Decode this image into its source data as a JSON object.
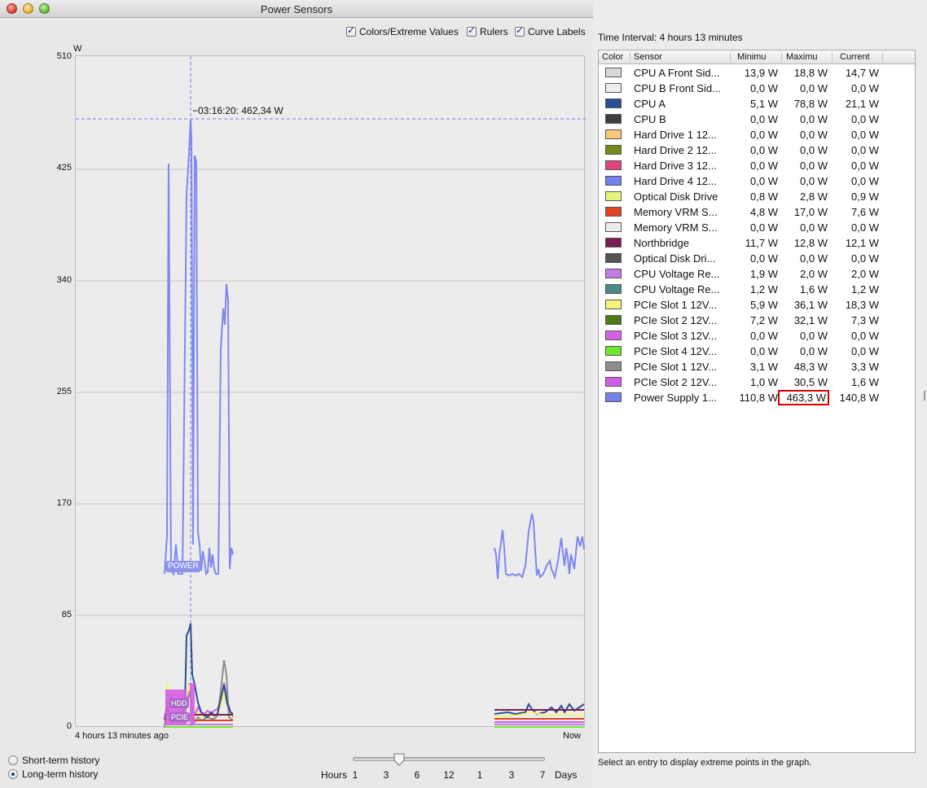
{
  "window": {
    "title": "Power Sensors",
    "options": [
      {
        "label": "Colors/Extreme Values",
        "checked": true
      },
      {
        "label": "Rulers",
        "checked": true
      },
      {
        "label": "Curve Labels",
        "checked": true
      }
    ]
  },
  "graph": {
    "unit": "W",
    "yticks": [
      "510",
      "425",
      "340",
      "255",
      "170",
      "85",
      "0"
    ],
    "x_left_label": "4 hours 13 minutes  ago",
    "x_right_label": "Now",
    "ruler_label": "−03:16:20: 462,34 W",
    "curve_label_power": "POWER",
    "curve_label_pcie": "PCIE",
    "curve_label_hdd": "HDD"
  },
  "chart_data": {
    "type": "line",
    "xlabel": "",
    "ylabel": "W",
    "ylim": [
      0,
      510
    ],
    "grid": true,
    "series": [
      {
        "name": "Power Supply",
        "color": "#7f88f0",
        "note_points_w": [
          120,
          430,
          120,
          130,
          120,
          432,
          462,
          120,
          432,
          130,
          120,
          120,
          330,
          345,
          130,
          120,
          120,
          135,
          160,
          120,
          140,
          145,
          150
        ]
      },
      {
        "name": "CPU A",
        "color": "#2b4f92",
        "peak_w": 79
      }
    ]
  },
  "history": {
    "short_label": "Short-term history",
    "long_label": "Long-term history",
    "selected": "long"
  },
  "slider": {
    "hours_label": "Hours",
    "days_label": "Days",
    "ticks": [
      "1",
      "3",
      "6",
      "12",
      "1",
      "3",
      "7"
    ]
  },
  "panel": {
    "interval": "Time Interval: 4 hours 13 minutes",
    "columns": {
      "color": "Color",
      "sensor": "Sensor",
      "min": "Minimu",
      "max": "Maximu",
      "current": "Current"
    },
    "status": "Select an entry to display extreme points in the graph."
  },
  "sensors": [
    {
      "name": "CPU A Front Sid...",
      "color": "#d9d9d9",
      "min": "13,9 W",
      "max": "18,8 W",
      "cur": "14,7 W"
    },
    {
      "name": "CPU B Front Sid...",
      "color": "#eeeeee",
      "min": "0,0 W",
      "max": "0,0 W",
      "cur": "0,0 W"
    },
    {
      "name": "CPU A",
      "color": "#2b4f92",
      "min": "5,1 W",
      "max": "78,8 W",
      "cur": "21,1 W"
    },
    {
      "name": "CPU B",
      "color": "#3d3d3d",
      "min": "0,0 W",
      "max": "0,0 W",
      "cur": "0,0 W"
    },
    {
      "name": "Hard Drive 1 12...",
      "color": "#f8c87a",
      "min": "0,0 W",
      "max": "0,0 W",
      "cur": "0,0 W"
    },
    {
      "name": "Hard Drive 2 12...",
      "color": "#6f8a1e",
      "min": "0,0 W",
      "max": "0,0 W",
      "cur": "0,0 W"
    },
    {
      "name": "Hard Drive 3 12...",
      "color": "#e0457f",
      "min": "0,0 W",
      "max": "0,0 W",
      "cur": "0,0 W"
    },
    {
      "name": "Hard Drive 4 12...",
      "color": "#7480ee",
      "min": "0,0 W",
      "max": "0,0 W",
      "cur": "0,0 W"
    },
    {
      "name": "Optical Disk Drive",
      "color": "#e6f57a",
      "min": "0,8 W",
      "max": "2,8 W",
      "cur": "0,9 W"
    },
    {
      "name": "Memory VRM S...",
      "color": "#e0451f",
      "min": "4,8 W",
      "max": "17,0 W",
      "cur": "7,6 W"
    },
    {
      "name": "Memory VRM S...",
      "color": "#eeeeee",
      "min": "0,0 W",
      "max": "0,0 W",
      "cur": "0,0 W"
    },
    {
      "name": "Northbridge",
      "color": "#7a2050",
      "min": "11,7 W",
      "max": "12,8 W",
      "cur": "12,1 W"
    },
    {
      "name": "Optical Disk Dri...",
      "color": "#555555",
      "min": "0,0 W",
      "max": "0,0 W",
      "cur": "0,0 W"
    },
    {
      "name": "CPU Voltage Re...",
      "color": "#c57ae8",
      "min": "1,9 W",
      "max": "2,0 W",
      "cur": "2,0 W"
    },
    {
      "name": "CPU Voltage Re...",
      "color": "#4a8a8a",
      "min": "1,2 W",
      "max": "1,6 W",
      "cur": "1,2 W"
    },
    {
      "name": "PCIe Slot 1 12V...",
      "color": "#f6f37a",
      "min": "5,9 W",
      "max": "36,1 W",
      "cur": "18,3 W"
    },
    {
      "name": "PCIe Slot 2 12V...",
      "color": "#4d7a14",
      "min": "7,2 W",
      "max": "32,1 W",
      "cur": "7,3 W"
    },
    {
      "name": "PCIe Slot 3 12V...",
      "color": "#d85ee8",
      "min": "0,0 W",
      "max": "0,0 W",
      "cur": "0,0 W"
    },
    {
      "name": "PCIe Slot 4 12V...",
      "color": "#6ee82a",
      "min": "0,0 W",
      "max": "0,0 W",
      "cur": "0,0 W"
    },
    {
      "name": "PCIe Slot 1 12V...",
      "color": "#8d8d8d",
      "min": "3,1 W",
      "max": "48,3 W",
      "cur": "3,3 W"
    },
    {
      "name": "PCIe Slot 2 12V...",
      "color": "#d05ee8",
      "min": "1,0 W",
      "max": "30,5 W",
      "cur": "1,6 W"
    },
    {
      "name": "Power Supply 1...",
      "color": "#7880ee",
      "min": "110,8 W",
      "max": "463,3 W",
      "cur": "140,8 W",
      "max_highlight": true
    }
  ]
}
